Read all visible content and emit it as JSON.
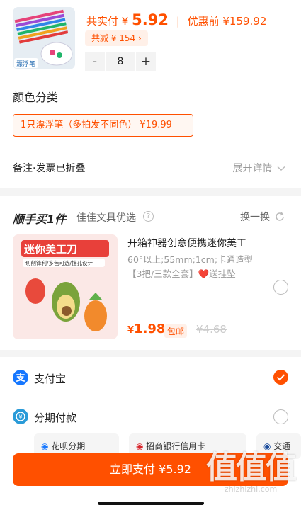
{
  "product": {
    "thumb_caption": "漂浮笔",
    "price_label": "共实付",
    "price_symbol": "¥",
    "price": "5.92",
    "original_label": "优惠前",
    "original_price": "¥159.92",
    "discount_text": "共减 ¥ 154 ›",
    "quantity": "8",
    "minus_label": "-",
    "plus_label": "+"
  },
  "spec": {
    "title": "颜色分类",
    "selected": "1只漂浮笔（多拍发不同色）  ¥19.99"
  },
  "remark": {
    "label": "备注·发票已折叠",
    "expand_label": "展开详情"
  },
  "addon": {
    "title": "顺手买1件",
    "shop": "佳佳文具优选",
    "swap_label": "换一换",
    "image_banner": "迷你美工刀",
    "image_subbanner": "切削锋利/多色可选/挂孔设计",
    "name": "开箱神器创意便携迷你美工",
    "desc": "60°以上;55mm;1cm;卡通造型【3把/三款全套】❤️送挂坠",
    "price_symbol": "¥",
    "price": "1.98",
    "free_ship": "包邮",
    "original_price": "¥4.68"
  },
  "payment": {
    "methods": [
      {
        "label": "支付宝",
        "checked": true
      },
      {
        "label": "分期付款",
        "checked": false
      }
    ],
    "cards": [
      "花呗分期",
      "招商银行信用卡",
      "交通"
    ]
  },
  "pay_button": "立即支付 ¥5.92",
  "watermark": {
    "text": "值值值",
    "url": "zhizhizhi.com"
  },
  "colors": {
    "accent": "#ff5000",
    "alipay": "#1677ff",
    "installment": "#2a9bd8"
  }
}
